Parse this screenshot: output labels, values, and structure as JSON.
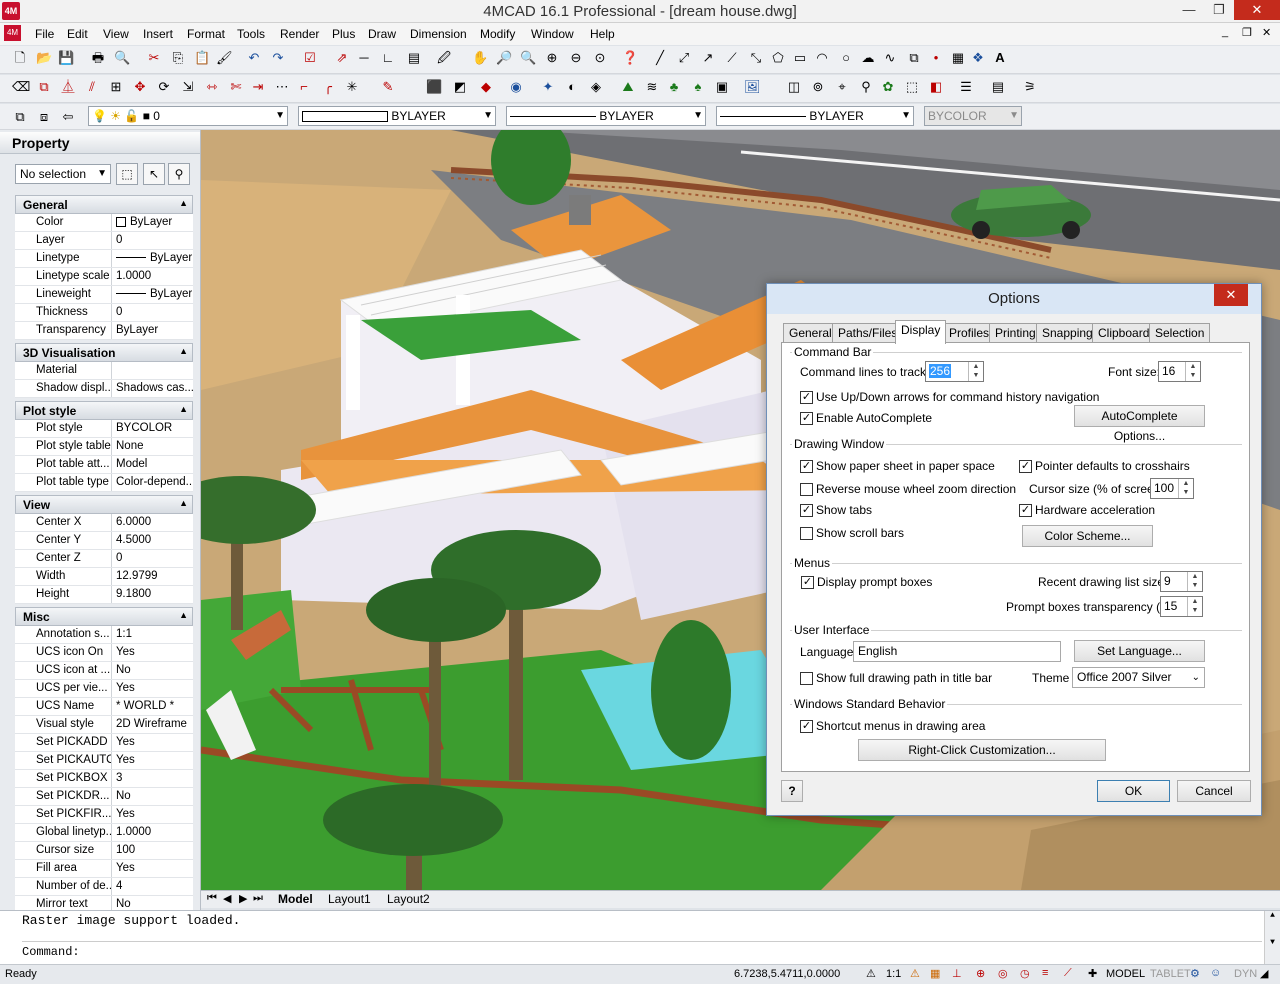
{
  "app": {
    "title": "4MCAD 16.1 Professional - [dream house.dwg]",
    "icon_label": "4M",
    "window_buttons": {
      "minimize": "—",
      "restore": "❐",
      "close": "✕"
    },
    "mdi_buttons": {
      "minimize": "_",
      "restore": "❐",
      "close": "✕"
    }
  },
  "menu": [
    "File",
    "Edit",
    "View",
    "Insert",
    "Format",
    "Tools",
    "Render",
    "Plus",
    "Draw",
    "Dimension",
    "Modify",
    "Window",
    "Help"
  ],
  "toolbar": {
    "layer_value": "0",
    "linetype1": "BYLAYER",
    "linetype2": "BYLAYER",
    "lineweight": "BYLAYER",
    "plotstyle": "BYCOLOR"
  },
  "property_panel": {
    "title": "Property",
    "selection": "No selection",
    "sections": [
      {
        "name": "General",
        "rows": [
          {
            "k": "Color",
            "v": "ByLayer"
          },
          {
            "k": "Layer",
            "v": "0"
          },
          {
            "k": "Linetype",
            "v": "ByLayer"
          },
          {
            "k": "Linetype scale",
            "v": "1.0000"
          },
          {
            "k": "Lineweight",
            "v": "ByLayer"
          },
          {
            "k": "Thickness",
            "v": "0"
          },
          {
            "k": "Transparency",
            "v": "ByLayer"
          }
        ]
      },
      {
        "name": "3D Visualisation",
        "rows": [
          {
            "k": "Material",
            "v": ""
          },
          {
            "k": "Shadow displ...",
            "v": "Shadows cas..."
          }
        ]
      },
      {
        "name": "Plot style",
        "rows": [
          {
            "k": "Plot style",
            "v": "BYCOLOR"
          },
          {
            "k": "Plot style table",
            "v": "None"
          },
          {
            "k": "Plot table att...",
            "v": "Model"
          },
          {
            "k": "Plot table type",
            "v": "Color-depend..."
          }
        ]
      },
      {
        "name": "View",
        "rows": [
          {
            "k": "Center X",
            "v": "6.0000"
          },
          {
            "k": "Center Y",
            "v": "4.5000"
          },
          {
            "k": "Center Z",
            "v": "0"
          },
          {
            "k": "Width",
            "v": "12.9799"
          },
          {
            "k": "Height",
            "v": "9.1800"
          }
        ]
      },
      {
        "name": "Misc",
        "rows": [
          {
            "k": "Annotation s...",
            "v": "1:1"
          },
          {
            "k": "UCS icon On",
            "v": "Yes"
          },
          {
            "k": "UCS icon at ...",
            "v": "No"
          },
          {
            "k": "UCS per vie...",
            "v": "Yes"
          },
          {
            "k": "UCS Name",
            "v": "* WORLD *"
          },
          {
            "k": "Visual style",
            "v": "2D Wireframe"
          },
          {
            "k": "Set PICKADD",
            "v": "Yes"
          },
          {
            "k": "Set PICKAUTO",
            "v": "Yes"
          },
          {
            "k": "Set PICKBOX",
            "v": "3"
          },
          {
            "k": "Set PICKDR...",
            "v": "No"
          },
          {
            "k": "Set PICKFIR...",
            "v": "Yes"
          },
          {
            "k": "Global linetyp...",
            "v": "1.0000"
          },
          {
            "k": "Cursor size",
            "v": "100"
          },
          {
            "k": "Fill area",
            "v": "Yes"
          },
          {
            "k": "Number of de...",
            "v": "4"
          },
          {
            "k": "Mirror text",
            "v": "No"
          }
        ]
      }
    ]
  },
  "tabs": [
    "Model",
    "Layout1",
    "Layout2"
  ],
  "command": {
    "history": "Raster image support loaded.",
    "prompt": "Command:"
  },
  "status": {
    "ready": "Ready",
    "coords": "6.7238,5.4711,0.0000",
    "scale": "1:1",
    "model": "MODEL",
    "tablet": "TABLET",
    "dyn": "DYN"
  },
  "dialog": {
    "title": "Options",
    "close": "✕",
    "tabs": [
      "General",
      "Paths/Files",
      "Display",
      "Profiles",
      "Printing",
      "Snapping",
      "Clipboard",
      "Selection"
    ],
    "active_tab": "Display",
    "command_bar": {
      "title": "Command Bar",
      "lines_label": "Command lines to track:",
      "lines_value": "256",
      "font_label": "Font size:",
      "font_value": "16",
      "updown_label": "Use Up/Down arrows for command history navigation",
      "autocomplete_label": "Enable AutoComplete",
      "autocomplete_btn": "AutoComplete Options..."
    },
    "drawing_window": {
      "title": "Drawing Window",
      "paper_sheet": "Show paper sheet in paper space",
      "pointer_crosshairs": "Pointer defaults to crosshairs",
      "reverse_wheel": "Reverse mouse wheel zoom direction",
      "cursor_size_label": "Cursor size (% of screen):",
      "cursor_size_value": "100",
      "show_tabs": "Show tabs",
      "hw_accel": "Hardware acceleration",
      "scroll_bars": "Show scroll bars",
      "color_scheme_btn": "Color Scheme..."
    },
    "menus": {
      "title": "Menus",
      "prompt_boxes": "Display prompt boxes",
      "recent_label": "Recent drawing list size:",
      "recent_value": "9",
      "transparency_label": "Prompt boxes transparency (%):",
      "transparency_value": "15"
    },
    "ui": {
      "title": "User Interface",
      "language_label": "Language",
      "language_value": "English",
      "set_language_btn": "Set Language...",
      "full_path": "Show full drawing path in title bar",
      "theme_label": "Theme",
      "theme_value": "Office 2007 Silver"
    },
    "wsb": {
      "title": "Windows Standard Behavior",
      "shortcut_menus": "Shortcut menus in drawing area",
      "rightclick_btn": "Right-Click Customization..."
    },
    "help": "?",
    "ok": "OK",
    "cancel": "Cancel"
  }
}
